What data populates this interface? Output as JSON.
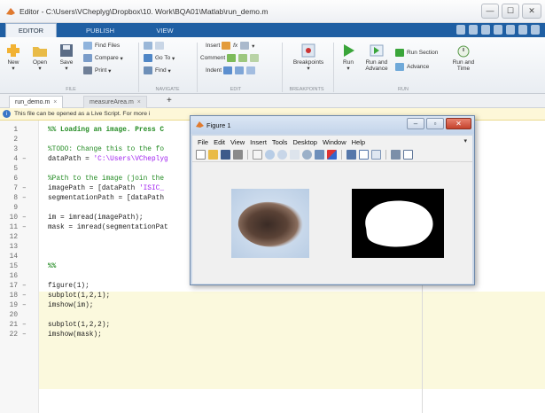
{
  "window": {
    "title": "Editor - C:\\Users\\VCheplyg\\Dropbox\\10. Work\\BQA01\\Matlab\\run_demo.m",
    "minimize": "—",
    "maximize": "☐",
    "close": "✕"
  },
  "ribbon_tabs": [
    "EDITOR",
    "PUBLISH",
    "VIEW"
  ],
  "ribbon": {
    "file": {
      "new": "New",
      "open": "Open",
      "save": "Save",
      "find_files": "Find Files",
      "compare": "Compare",
      "print": "Print",
      "group": "FILE"
    },
    "navigate": {
      "go_to": "Go To",
      "find": "Find",
      "group": "NAVIGATE"
    },
    "edit": {
      "insert": "Insert",
      "comment": "Comment",
      "indent": "Indent",
      "fx": "fx",
      "group": "EDIT"
    },
    "breakpoints": {
      "label": "Breakpoints",
      "group": "BREAKPOINTS"
    },
    "run": {
      "run": "Run",
      "run_and_advance": "Run and Advance",
      "run_section": "Run Section",
      "advance": "Advance",
      "run_and_time": "Run and Time",
      "group": "RUN"
    }
  },
  "doc_tabs": [
    {
      "label": "run_demo.m",
      "close": "×"
    },
    {
      "label": "measureArea.m",
      "close": "×"
    }
  ],
  "doc_tab_add": "+",
  "infobar": {
    "text": "This file can be opened as a Live Script. For more i"
  },
  "code_lines": [
    {
      "n": "1",
      "dash": "",
      "text": "%% Loading an image. Press C"
    },
    {
      "n": "2",
      "dash": "",
      "text": ""
    },
    {
      "n": "3",
      "dash": "",
      "text": "%TODO: Change this to the fo"
    },
    {
      "n": "4",
      "dash": "–",
      "text": "dataPath = 'C:\\Users\\VCheplyg"
    },
    {
      "n": "5",
      "dash": "",
      "text": ""
    },
    {
      "n": "6",
      "dash": "",
      "text": "%Path to the image (join the"
    },
    {
      "n": "7",
      "dash": "–",
      "text": "imagePath = [dataPath 'ISIC_"
    },
    {
      "n": "8",
      "dash": "–",
      "text": "segmentationPath = [dataPath"
    },
    {
      "n": "9",
      "dash": "",
      "text": ""
    },
    {
      "n": "10",
      "dash": "–",
      "text": "im = imread(imagePath);"
    },
    {
      "n": "11",
      "dash": "–",
      "text": "mask = imread(segmentationPat"
    },
    {
      "n": "12",
      "dash": "",
      "text": ""
    },
    {
      "n": "13",
      "dash": "",
      "text": ""
    },
    {
      "n": "14",
      "dash": "",
      "text": ""
    },
    {
      "n": "15",
      "dash": "",
      "text": "%%"
    },
    {
      "n": "16",
      "dash": "",
      "text": ""
    },
    {
      "n": "17",
      "dash": "–",
      "text": "figure(1);"
    },
    {
      "n": "18",
      "dash": "–",
      "text": "subplot(1,2,1);"
    },
    {
      "n": "19",
      "dash": "–",
      "text": "imshow(im);"
    },
    {
      "n": "20",
      "dash": "",
      "text": ""
    },
    {
      "n": "21",
      "dash": "–",
      "text": "subplot(1,2,2);"
    },
    {
      "n": "22",
      "dash": "–",
      "text": "imshow(mask);"
    }
  ],
  "figure": {
    "title": "Figure 1",
    "menus": [
      "File",
      "Edit",
      "View",
      "Insert",
      "Tools",
      "Desktop",
      "Window",
      "Help"
    ],
    "minimize": "–",
    "maximize": "▫",
    "close": "✕",
    "menu_arrow": "▾"
  },
  "colors": {
    "accent": "#1f5fa3",
    "comment": "#228b22",
    "string": "#a020f0",
    "cell_highlight": "#fbf9dd",
    "infobar": "#fdf7d8"
  }
}
